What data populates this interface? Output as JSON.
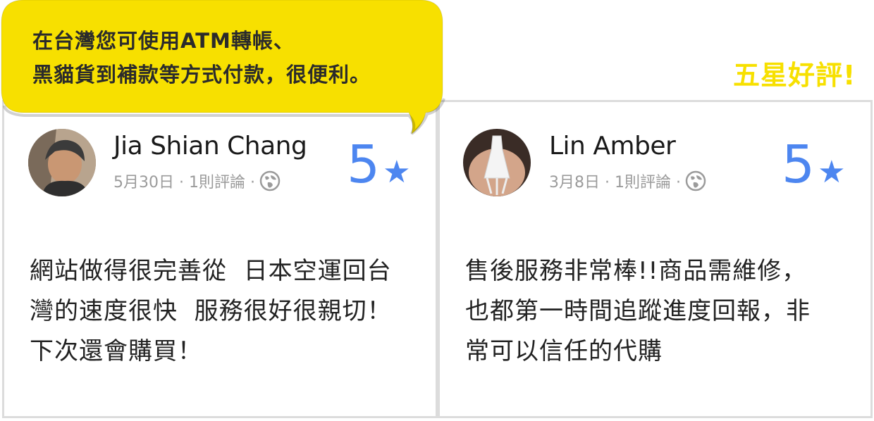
{
  "bubble": {
    "line1": "在台灣您可使用ATM轉帳、",
    "line2": "黑貓貨到補款等方式付款，很便利。"
  },
  "headline": "五星好評!",
  "reviews": [
    {
      "name": "Jia Shian Chang",
      "meta": "5月30日 · 1則評論 ·",
      "score": "5",
      "star": "★",
      "lines": [
        "網站做得很完善從  日本空運回台",
        "灣的速度很快  服務很好很親切！",
        "下次還會購買！"
      ]
    },
    {
      "name": "Lin Amber",
      "meta": "3月8日 · 1則評論 ·",
      "score": "5",
      "star": "★",
      "lines": [
        "售後服務非常棒!!商品需維修，",
        "也都第一時間追蹤進度回報，非",
        "常可以信任的代購"
      ]
    }
  ],
  "colors": {
    "accent_yellow": "#f7e000",
    "score_blue": "#4d86f0",
    "meta_gray": "#9b9b9b",
    "border_gray": "#dcdcdc"
  },
  "icons": [
    "globe-icon",
    "star-icon"
  ]
}
